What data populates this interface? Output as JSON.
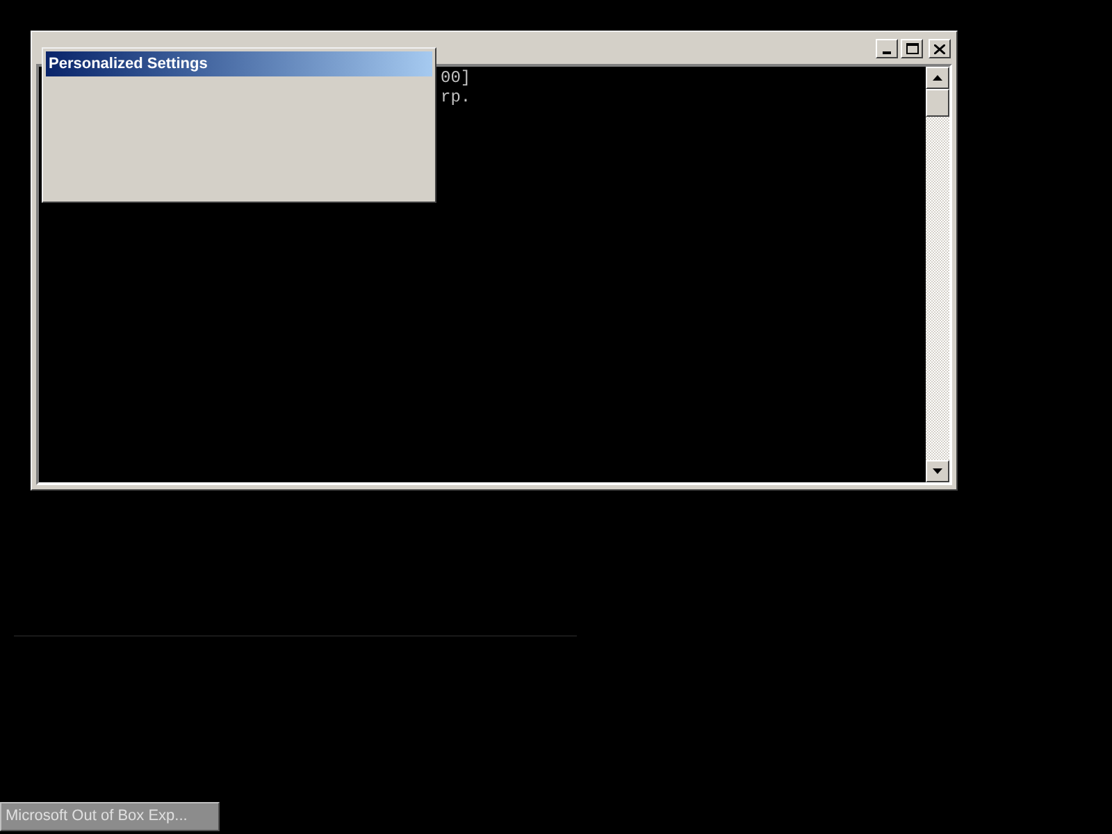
{
  "console_window": {
    "lines": [
      "00]",
      "rp."
    ]
  },
  "dialog": {
    "title": "Personalized Settings"
  },
  "taskbar": {
    "buttons": [
      {
        "label": "Microsoft Out of Box Exp..."
      }
    ]
  }
}
